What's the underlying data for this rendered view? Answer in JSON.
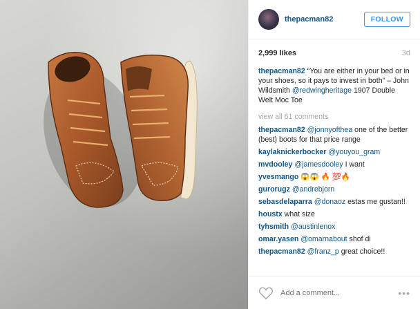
{
  "post": {
    "username": "thepacman82",
    "follow_label": "FOLLOW",
    "likes": "2,999 likes",
    "time": "3d"
  },
  "caption": {
    "user": "thepacman82",
    "text1": "“You are either in your bed or in your shoes, so it pays to invest in both” – John Wildsmith",
    "mention": "@redwingheritage",
    "text2": "1907 Double Welt Moc Toe"
  },
  "view_all": "view all 61 comments",
  "comments": [
    {
      "user": "thepacman82",
      "mention": "@jonnyofthea",
      "text": "one of the better (best) boots for that price range"
    },
    {
      "user": "kaylaknickerbocker",
      "mention": "@youyou_gram",
      "text": ""
    },
    {
      "user": "mvdooley",
      "mention": "@jamesdooley",
      "text": "I want"
    },
    {
      "user": "yvesmango",
      "mention": "",
      "text": "😱😱 🔥 💯🔥"
    },
    {
      "user": "gurorugz",
      "mention": "@andrebjorn",
      "text": ""
    },
    {
      "user": "sebasdelaparra",
      "mention": "@donaoz",
      "text": "estas me gustan!!"
    },
    {
      "user": "houstx",
      "mention": "",
      "text": "what size"
    },
    {
      "user": "tyhsmith",
      "mention": "@austinlenox",
      "text": ""
    },
    {
      "user": "omar.yasen",
      "mention": "@omarnabout",
      "text": "shof di"
    },
    {
      "user": "thepacman82",
      "mention": "@franz_p",
      "text": "great choice!!"
    }
  ],
  "add_comment_placeholder": "Add a comment...",
  "more_label": "•••",
  "icons": {
    "heart": "heart-icon",
    "more": "more-options-icon"
  },
  "colors": {
    "link": "#125688",
    "follow": "#3897f0",
    "muted": "#a5a7aa",
    "boot_leather": "#b0622f"
  }
}
